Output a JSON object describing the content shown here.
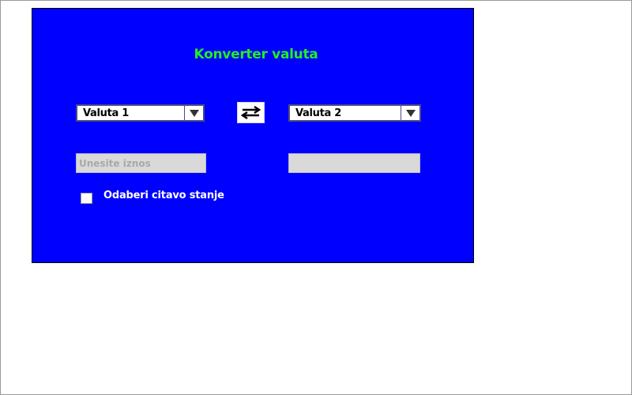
{
  "window": {
    "title": "Konverter valuta"
  },
  "converter": {
    "from_currency": {
      "selected": "Valuta 1",
      "icon": "chevron-down-icon"
    },
    "to_currency": {
      "selected": "Valuta 2",
      "icon": "chevron-down-icon"
    },
    "swap_icon": "swap-arrows-icon",
    "amount_input": {
      "placeholder": "Unesite iznos",
      "value": ""
    },
    "result_field": {
      "value": ""
    },
    "whole_balance_checkbox": {
      "label": "Odaberi citavo stanje",
      "checked": false
    }
  },
  "colors": {
    "panel_background": "#0000ff",
    "title_color": "#22ee22",
    "field_background": "#d9d9d9",
    "label_color": "#ffffff"
  }
}
